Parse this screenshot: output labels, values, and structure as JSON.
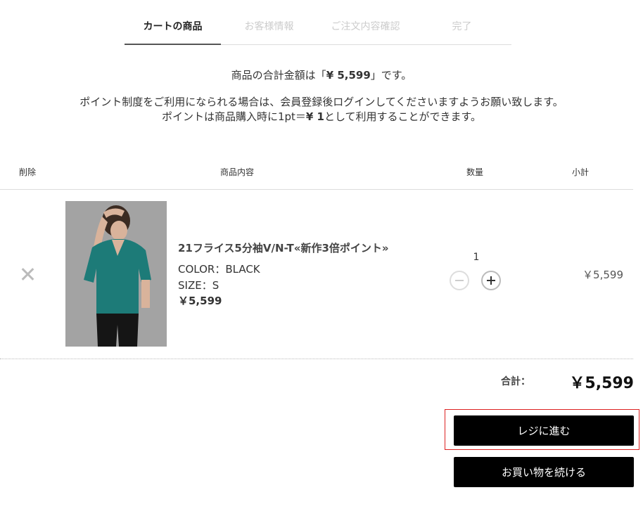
{
  "steps": [
    {
      "label": "カートの商品",
      "active": true
    },
    {
      "label": "お客様情報",
      "active": false
    },
    {
      "label": "ご注文内容確認",
      "active": false
    },
    {
      "label": "完了",
      "active": false
    }
  ],
  "summary": {
    "prefix": "商品の合計金額は「",
    "amount": "¥ 5,599",
    "suffix": "」です。"
  },
  "notice": {
    "line1": "ポイント制度をご利用になられる場合は、会員登録後ログインしてくださいますようお願い致します。",
    "line2_prefix": "ポイントは商品購入時に1pt＝",
    "line2_amount": "¥ 1",
    "line2_suffix": "として利用することができます。"
  },
  "table": {
    "headers": {
      "delete": "削除",
      "content": "商品内容",
      "quantity": "数量",
      "subtotal": "小計"
    }
  },
  "item": {
    "name": "21フライス5分袖V/N-T«新作3倍ポイント»",
    "color": "COLOR：BLACK",
    "size": "SIZE：S",
    "price": "￥5,599",
    "quantity": "1",
    "subtotal": "￥5,599",
    "image_colors": {
      "shirt": "#1d7b78",
      "background": "#9c9c9c"
    }
  },
  "total": {
    "label": "合計：",
    "value": "￥5,599"
  },
  "buttons": {
    "checkout": "レジに進む",
    "continue": "お買い物を続ける"
  },
  "colors": {
    "accent_highlight": "#dd2222",
    "button_bg": "#000000"
  }
}
